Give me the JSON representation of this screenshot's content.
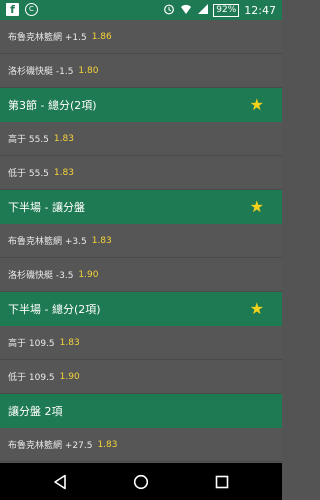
{
  "status_bar": {
    "facebook": "f",
    "app": "C",
    "battery": "92%",
    "time": "12:47"
  },
  "rows_top": [
    {
      "label": "布魯克林籃網 +1.5",
      "price": "1.86"
    },
    {
      "label": "洛杉磯快艇 -1.5",
      "price": "1.80"
    }
  ],
  "sections": [
    {
      "title": "第3節 - 總分(2項)",
      "starred": true,
      "rows": [
        {
          "label": "高于 55.5",
          "price": "1.83"
        },
        {
          "label": "低于 55.5",
          "price": "1.83"
        }
      ]
    },
    {
      "title": "下半場 - 讓分盤",
      "starred": true,
      "rows": [
        {
          "label": "布魯克林籃網 +3.5",
          "price": "1.83"
        },
        {
          "label": "洛杉磯快艇 -3.5",
          "price": "1.90"
        }
      ]
    },
    {
      "title": "下半場 - 總分(2項)",
      "starred": true,
      "rows": [
        {
          "label": "高于 109.5",
          "price": "1.83"
        },
        {
          "label": "低于 109.5",
          "price": "1.90"
        }
      ]
    },
    {
      "title": "讓分盤 2項",
      "starred": false,
      "rows": [
        {
          "label": "布魯克林籃網 +27.5",
          "price": "1.83"
        }
      ]
    }
  ],
  "nav": {
    "back": "back-icon",
    "home": "home-icon",
    "recents": "recents-icon"
  }
}
